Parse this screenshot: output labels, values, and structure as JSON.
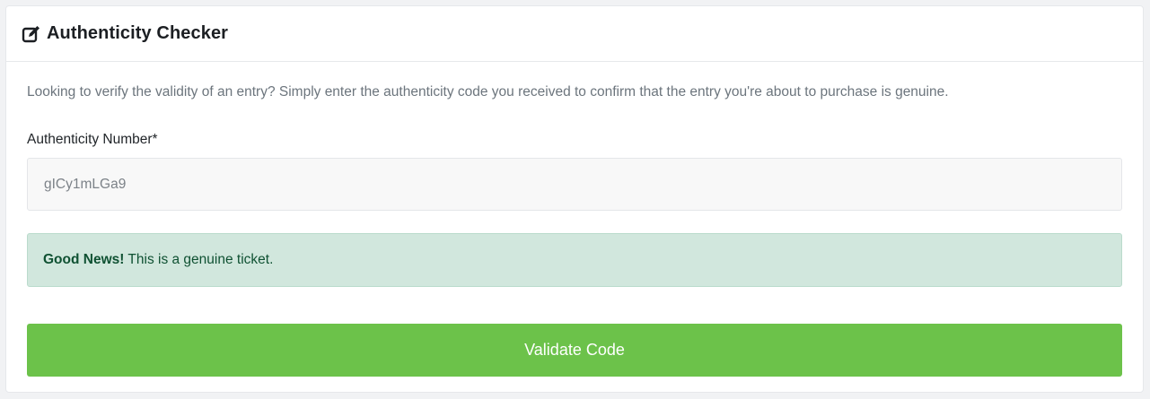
{
  "header": {
    "icon": "edit-icon",
    "title": "Authenticity Checker"
  },
  "body": {
    "description": "Looking to verify the validity of an entry? Simply enter the authenticity code you received to confirm that the entry you're about to purchase is genuine.",
    "field_label": "Authenticity Number*",
    "field_value": "gICy1mLGa9"
  },
  "alert": {
    "strong": "Good News!",
    "message": "This is a genuine ticket.",
    "color": "#d1e7dd"
  },
  "button": {
    "label": "Validate Code",
    "color": "#6cc24a"
  }
}
